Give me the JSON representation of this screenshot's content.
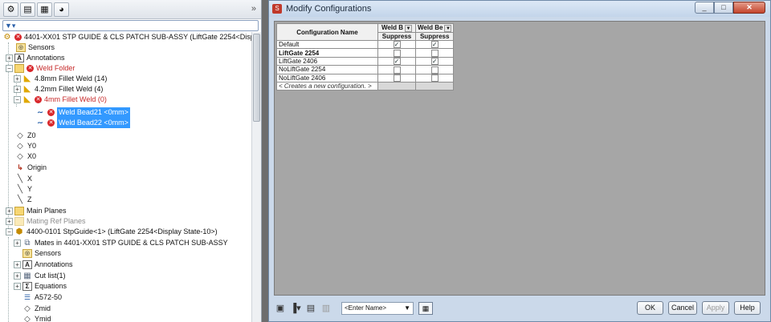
{
  "tree": {
    "filter_text": "▼▾",
    "rows": [
      {
        "label": "4401-XX01 STP GUIDE & CLS PATCH SUB-ASSY  (LiftGate 2254<Display",
        "style": "err-root"
      },
      {
        "label": "Sensors"
      },
      {
        "label": "Annotations"
      },
      {
        "label": "Weld Folder"
      },
      {
        "label": "4.8mm Fillet Weld (14)"
      },
      {
        "label": "4.2mm Fillet Weld (4)"
      },
      {
        "label": "4mm Fillet Weld (0)"
      },
      {
        "label": "Weld Bead21 <0mm>"
      },
      {
        "label": "Weld Bead22 <0mm>"
      },
      {
        "label": "Z0"
      },
      {
        "label": "Y0"
      },
      {
        "label": "X0"
      },
      {
        "label": "Origin"
      },
      {
        "label": "X"
      },
      {
        "label": "Y"
      },
      {
        "label": "Z"
      },
      {
        "label": "Main Planes"
      },
      {
        "label": "Mating Ref Planes"
      },
      {
        "label": "4400-0101 StpGuide<1> (LiftGate 2254<Display State-10>)"
      },
      {
        "label": "Mates in 4401-XX01 STP GUIDE & CLS PATCH SUB-ASSY"
      },
      {
        "label": "Sensors"
      },
      {
        "label": "Annotations"
      },
      {
        "label": "Cut list(1)"
      },
      {
        "label": "Equations"
      },
      {
        "label": "A572-50"
      },
      {
        "label": "Zmid"
      },
      {
        "label": "Ymid"
      }
    ]
  },
  "dialog": {
    "title": "Modify Configurations",
    "columns": {
      "name_header": "Configuration Name",
      "weld_b_header": "Weld B",
      "weld_be_header": "Weld Be",
      "suppress_label": "Suppress"
    },
    "rows": [
      {
        "name": "Default",
        "weld_b": true,
        "weld_be": true,
        "bold": false
      },
      {
        "name": "LiftGate 2254",
        "weld_b": false,
        "weld_be": false,
        "bold": true
      },
      {
        "name": "LiftGate 2406",
        "weld_b": true,
        "weld_be": true,
        "bold": false
      },
      {
        "name": "NoLiftGate 2254",
        "weld_b": false,
        "weld_be": false,
        "bold": false
      },
      {
        "name": "NoLiftGate 2406",
        "weld_b": false,
        "weld_be": false,
        "bold": false
      }
    ],
    "new_row_text": "< Creates a new configuration. >",
    "name_combo_value": "<Enter Name>",
    "buttons": {
      "ok": "OK",
      "cancel": "Cancel",
      "apply": "Apply",
      "help": "Help"
    }
  }
}
